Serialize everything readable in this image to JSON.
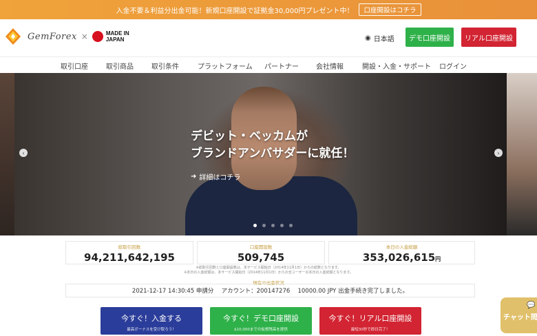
{
  "promo": {
    "text": "入金不要＆利益分出金可能！新規口座開設で証拠金30,000円プレゼント中！",
    "link": "口座開設はコチラ"
  },
  "header": {
    "logo_text": "GemForex",
    "logo_x": "×",
    "japan_line1": "MADE IN",
    "japan_line2": "JAPAN",
    "lang": "日本語",
    "demo_button": "デモ口座開設",
    "real_button": "リアル口座開設"
  },
  "nav": [
    "取引口座",
    "取引商品",
    "取引条件",
    "プラットフォーム",
    "パートナー",
    "会社情報",
    "開設・入金・サポート",
    "ログイン"
  ],
  "slide": {
    "title_line1": "デビット・ベッカムが",
    "title_line2": "ブランドアンバサダーに就任！",
    "more": "詳細はコチラ",
    "prev": "‹",
    "next": "›"
  },
  "stats": {
    "items": [
      {
        "label": "総取引回数",
        "value": "94,211,642,195",
        "unit": ""
      },
      {
        "label": "口座開設数",
        "value": "509,745",
        "unit": ""
      },
      {
        "label": "本日の入金総額",
        "value": "353,026,615",
        "unit": "円"
      }
    ],
    "note1": "※総取引回数と口座開設数は、本サービス開始日（2014年11月1日）からの総数となります。",
    "note2": "※本日の入金総額は、本サービス開始日（2014年11月1日）からの全ユーザーの本日の入金総額となります。",
    "status_label": "現在の出金状況",
    "status_text": "2021-12-17 14:30:45 申請分　 アカウント：200147276　 10000.00 JPY 出金手続き完了しました。"
  },
  "cta": [
    {
      "main": "今すぐ！入金する",
      "sub": "最高ボーナスを受け取ろう！",
      "color": "#2b3d9a"
    },
    {
      "main": "今すぐ！デモ口座開設",
      "sub": "$10,000までの仮想残高を提供",
      "color": "#2fb14a"
    },
    {
      "main": "今すぐ！リアル口座開設",
      "sub": "最短30秒で即日完了！",
      "color": "#d22432"
    }
  ],
  "chat": {
    "label": "チャット問"
  }
}
